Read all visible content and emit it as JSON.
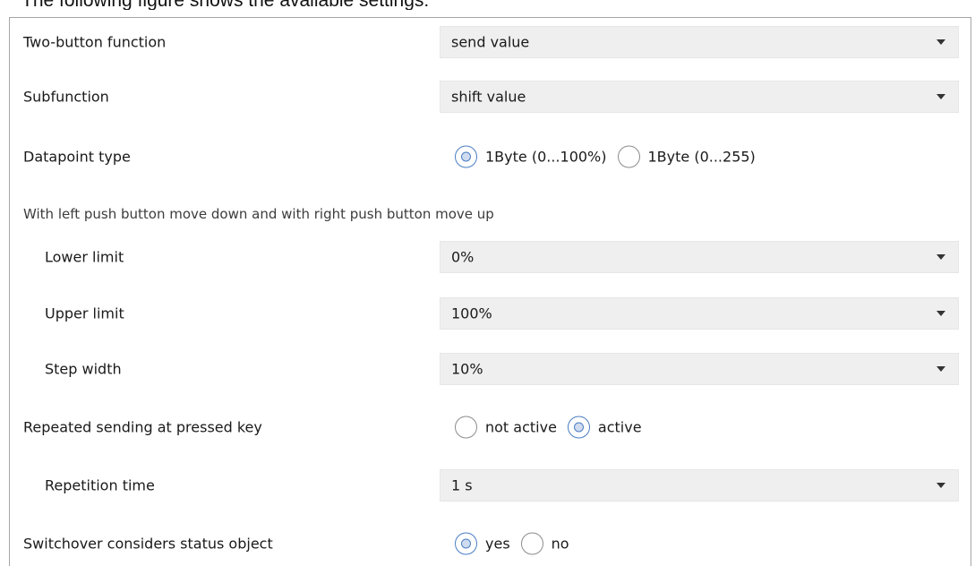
{
  "header_fragment": "The following figure shows the available settings:",
  "rows": {
    "two_button_function": {
      "label": "Two-button function",
      "value": "send value"
    },
    "subfunction": {
      "label": "Subfunction",
      "value": "shift value"
    },
    "datapoint_type": {
      "label": "Datapoint type",
      "options": [
        {
          "label": "1Byte (0...100%)",
          "selected": true
        },
        {
          "label": "1Byte (0...255)",
          "selected": false
        }
      ]
    },
    "info_text": "With left push button move down and with right push button move up",
    "lower_limit": {
      "label": "Lower limit",
      "value": "0%"
    },
    "upper_limit": {
      "label": "Upper limit",
      "value": "100%"
    },
    "step_width": {
      "label": "Step width",
      "value": "10%"
    },
    "repeated_sending": {
      "label": "Repeated sending at pressed key",
      "options": [
        {
          "label": "not active",
          "selected": false
        },
        {
          "label": "active",
          "selected": true
        }
      ]
    },
    "repetition_time": {
      "label": "Repetition time",
      "value": "1 s"
    },
    "switchover": {
      "label": "Switchover considers status object",
      "options": [
        {
          "label": "yes",
          "selected": true
        },
        {
          "label": "no",
          "selected": false
        }
      ]
    }
  },
  "icons": {
    "dropdown": "chevron-down-icon",
    "radio": "radio-button-icon"
  },
  "colors": {
    "select_bg": "#efefef",
    "radio_selected": "#4a7ec2",
    "border": "#a6a6a6"
  }
}
